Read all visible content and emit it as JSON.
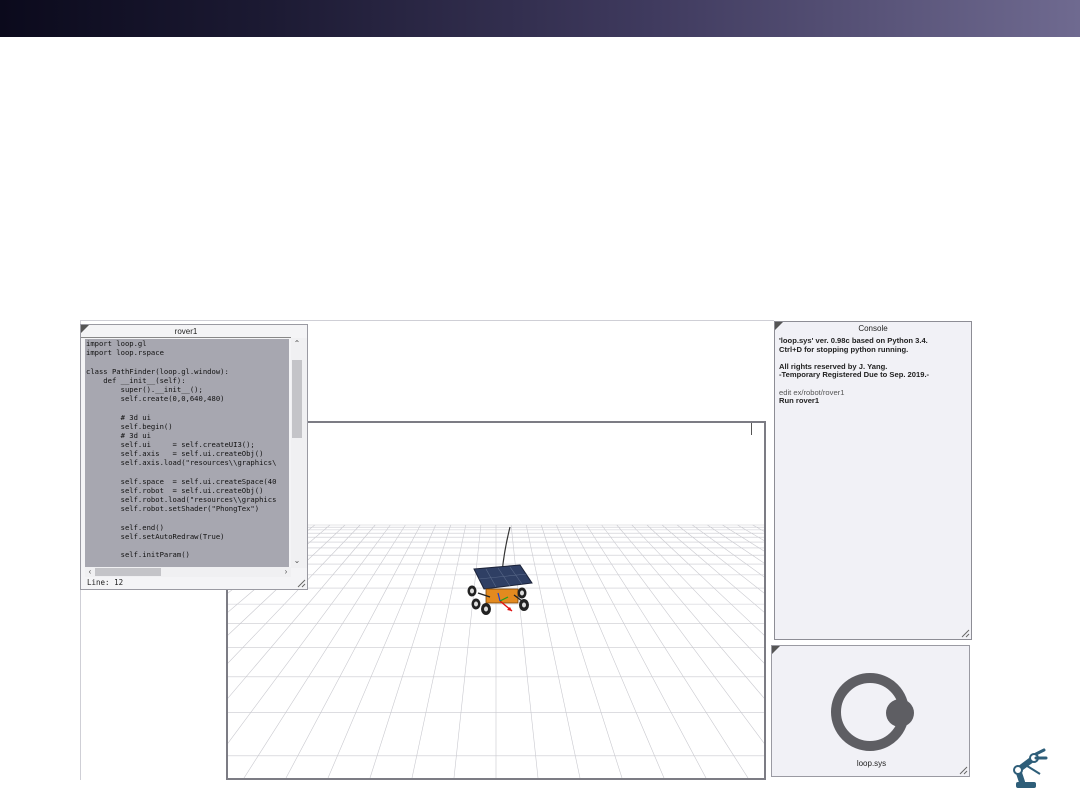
{
  "editor": {
    "title": "rover1",
    "code_lines": [
      "import loop.gl",
      "import loop.rspace",
      "",
      "class PathFinder(loop.gl.window):",
      "    def __init__(self):",
      "        super().__init__();",
      "        self.create(0,0,640,480)",
      "",
      "        # 3d ui",
      "        self.begin()",
      "        # 3d ui",
      "        self.ui     = self.createUI3();",
      "        self.axis   = self.ui.createObj()",
      "        self.axis.load(\"resources\\\\graphics\\",
      "",
      "        self.space  = self.ui.createSpace(40",
      "        self.robot  = self.ui.createObj()",
      "        self.robot.load(\"resources\\\\graphics",
      "        self.robot.setShader(\"PhongTex\")",
      "",
      "        self.end()",
      "        self.setAutoRedraw(True)",
      "",
      "        self.initParam()"
    ],
    "status": "Line: 12"
  },
  "console": {
    "title": "Console",
    "line1": "'loop.sys' ver. 0.98c based on Python 3.4.",
    "line2": "Ctrl+D for stopping python running.",
    "line3": "All rights reserved by J. Yang.",
    "line4": "-Temporary Registered Due to Sep. 2019.-",
    "line5": "edit ex/robot/rover1",
    "line6": "Run rover1"
  },
  "logo_panel": {
    "label": "loop.sys"
  },
  "colors": {
    "topbar_dark": "#0b0a1c",
    "topbar_light": "#6f6a90",
    "code_bg": "#a7a7b0",
    "logo_ring": "#5e5e63",
    "robot_icon": "#2e5e79"
  },
  "icons": {
    "robot_arm": "robot-arm-icon",
    "logo": "loop-sys-logo-icon"
  }
}
